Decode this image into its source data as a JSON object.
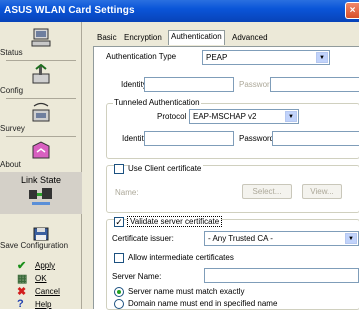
{
  "window": {
    "title": "ASUS WLAN Card Settings",
    "close_glyph": "×"
  },
  "sidebar": {
    "items": [
      {
        "label": "Status",
        "icon": "status-monitor-icon"
      },
      {
        "label": "Config",
        "icon": "config-icon"
      },
      {
        "label": "Survey",
        "icon": "survey-icon"
      },
      {
        "label": "About",
        "icon": "about-icon"
      }
    ],
    "link_state_label": "Link State",
    "save_label": "Save Configuration",
    "actions": [
      {
        "label": "Apply",
        "glyph": "✔"
      },
      {
        "label": "OK",
        "glyph": "▦"
      },
      {
        "label": "Cancel",
        "glyph": "✖"
      },
      {
        "label": "Help",
        "glyph": "?"
      }
    ]
  },
  "tabs": [
    {
      "label": "Basic"
    },
    {
      "label": "Encryption"
    },
    {
      "label": "Authentication"
    },
    {
      "label": "Advanced"
    }
  ],
  "auth": {
    "type_label": "Authentication Type",
    "type_value": "PEAP",
    "identity_label": "Identity",
    "password_label": "Password",
    "tunneled": {
      "title": "Tunneled Authentication",
      "protocol_label": "Protocol",
      "protocol_value": "EAP-MSCHAP v2",
      "identity_label": "Identity",
      "password_label": "Password"
    },
    "client_cert": {
      "checkbox_label": "Use Client certificate",
      "name_label": "Name:",
      "select_btn": "Select...",
      "view_btn": "View..."
    },
    "server_cert": {
      "validate_label": "Validate server certificate",
      "issuer_label": "Certificate issuer:",
      "issuer_value": "- Any Trusted CA -",
      "allow_intermediate_label": "Allow intermediate certificates",
      "server_name_label": "Server Name:",
      "match_exact_label": "Server name must match exactly",
      "domain_end_label": "Domain name must end in specified name"
    }
  },
  "colors": {
    "title_bar": "#0a55d8",
    "panel_bg": "#ffffff",
    "window_bg": "#ece9d8"
  }
}
